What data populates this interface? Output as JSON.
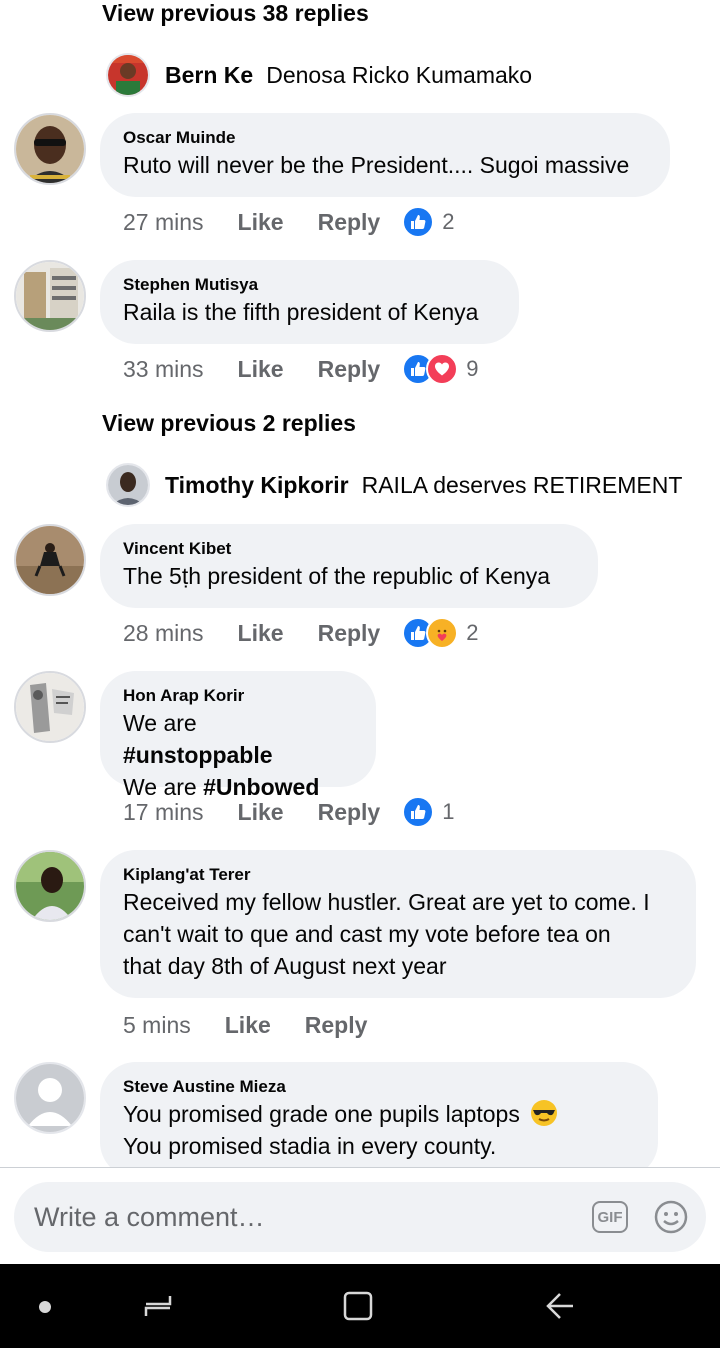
{
  "thread": {
    "view_prev_1": "View previous 38 replies",
    "preview_1": {
      "name": "Bern Ke",
      "text": "Denosa Ricko Kumamako"
    },
    "view_prev_2": "View previous 2 replies",
    "preview_2": {
      "name": "Timothy Kipkorir",
      "text": "RAILA deserves RETIREMENT"
    }
  },
  "comments": [
    {
      "author": "Oscar Muinde",
      "text": "Ruto will never be the President.... Sugoi massive",
      "time": "27 mins",
      "like": "Like",
      "reply": "Reply",
      "reactions": [
        "like"
      ],
      "count": "2"
    },
    {
      "author": "Stephen Mutisya",
      "text": "Raila is the fifth president of Kenya",
      "time": "33 mins",
      "like": "Like",
      "reply": "Reply",
      "reactions": [
        "like",
        "love"
      ],
      "count": "9"
    },
    {
      "author": "Vincent Kibet",
      "text": "The 5ṭh president of the republic of Kenya",
      "time": "28 mins",
      "like": "Like",
      "reply": "Reply",
      "reactions": [
        "like",
        "care"
      ],
      "count": "2"
    },
    {
      "author": "Hon Arap Korir",
      "line1_prefix": "We are ",
      "line1_tag": "#unstoppable",
      "line2_prefix": "We are ",
      "line2_tag": "#Unbowed",
      "time": "17 mins",
      "like": "Like",
      "reply": "Reply",
      "reactions": [
        "like"
      ],
      "count": "1"
    },
    {
      "author": "Kiplang'at Terer",
      "line1": "Received my fellow hustler. Great are yet to come. I",
      "line2": "can't wait to que and cast my vote before tea on",
      "line3": "that day 8th of August next year",
      "time": "5 mins",
      "like": "Like",
      "reply": "Reply"
    },
    {
      "author": "Steve Austine Mieza",
      "line1": "You promised  grade one pupils laptops",
      "line2": "You promised stadia in every county."
    }
  ],
  "composer": {
    "placeholder": "Write a comment…",
    "gif_label": "GIF",
    "icons": [
      "gif-icon",
      "smiley-icon"
    ]
  },
  "navbar": {
    "icons": [
      "dot-icon",
      "recents-icon",
      "home-icon",
      "back-icon"
    ]
  },
  "colors": {
    "like_blue": "#1877f2",
    "love_red": "#f33e58",
    "care_yellow": "#f7b125",
    "bubble_bg": "#f0f2f5",
    "meta_grey": "#65676b"
  }
}
